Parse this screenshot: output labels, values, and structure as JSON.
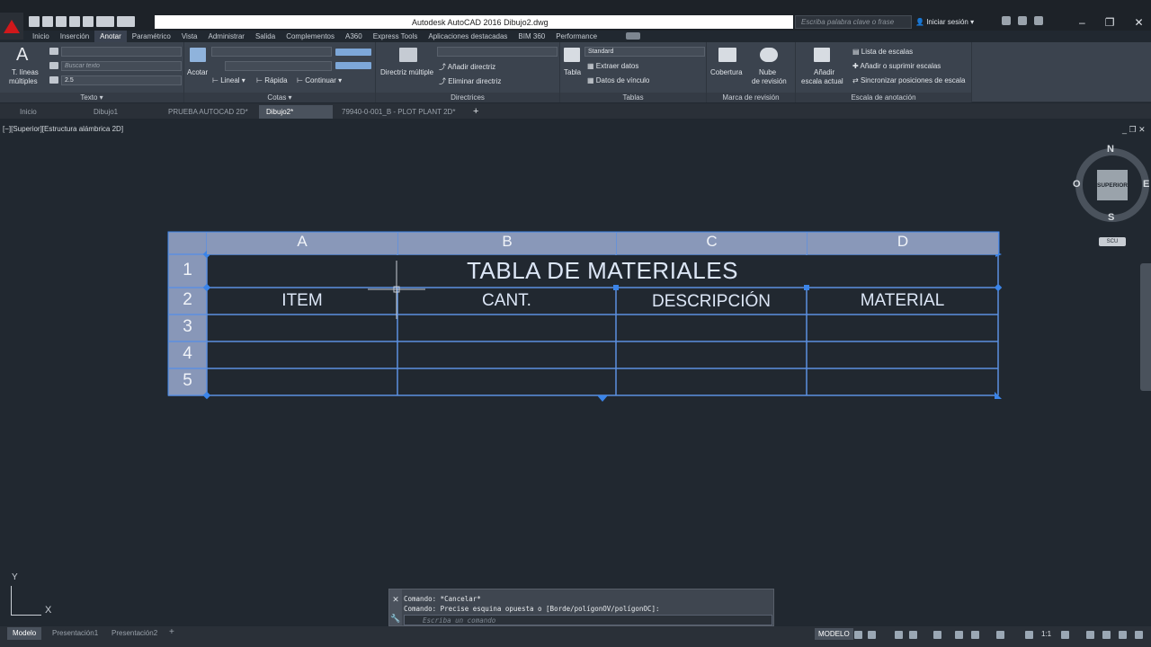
{
  "window": {
    "title": "Autodesk AutoCAD 2016   Dibujo2.dwg",
    "search_placeholder": "Escriba palabra clave o frase",
    "login": "Iniciar sesión"
  },
  "ribbon_tabs": [
    "Inicio",
    "Inserción",
    "Anotar",
    "Paramétrico",
    "Vista",
    "Administrar",
    "Salida",
    "Complementos",
    "A360",
    "Express Tools",
    "Aplicaciones destacadas",
    "BIM 360",
    "Performance"
  ],
  "ribbon": {
    "texto": {
      "multiline_label_1": "T. líneas",
      "multiline_label_2": "múltiples",
      "search_placeholder": "Buscar texto",
      "height_value": "2.5",
      "panel_title": "Texto"
    },
    "cotas": {
      "acotar": "Acotar",
      "lineal": "Lineal",
      "rapida": "Rápida",
      "continuar": "Continuar",
      "panel_title": "Cotas"
    },
    "directrices": {
      "multiple": "Directriz múltiple",
      "add": "Añadir directriz",
      "remove": "Eliminar directriz",
      "panel_title": "Directrices"
    },
    "tablas": {
      "tabla": "Tabla",
      "style": "Standard",
      "extract": "Extraer datos",
      "link": "Datos de vínculo",
      "panel_title": "Tablas"
    },
    "revision": {
      "cobertura": "Cobertura",
      "nube_1": "Nube",
      "nube_2": "de revisión",
      "panel_title": "Marca de revisión"
    },
    "escala": {
      "add_1": "Añadir",
      "add_2": "escala actual",
      "list": "Lista de escalas",
      "add_remove": "Añadir o suprimir escalas",
      "sync": "Sincronizar posiciones de escala",
      "panel_title": "Escala de anotación"
    }
  },
  "doc_tabs": [
    "Inicio",
    "Dibujo1",
    "PRUEBA AUTOCAD 2D*",
    "Dibujo2*",
    "79940-0-001_B - PLOT PLANT 2D*"
  ],
  "viewport_label": "[−][Superior][Estructura alámbrica 2D]",
  "viewport_controls": "_ ❐ ✕",
  "viewcube": {
    "face": "SUPERIOR",
    "n": "N",
    "s": "S",
    "e": "E",
    "w": "O",
    "ucs": "SCU"
  },
  "table": {
    "columns": [
      "A",
      "B",
      "C",
      "D"
    ],
    "rows": [
      "1",
      "2",
      "3",
      "4",
      "5"
    ],
    "title": "TABLA DE MATERIALES",
    "headers": [
      "ITEM",
      "CANT.",
      "DESCRIPCIÓN",
      "MATERIAL"
    ]
  },
  "ucs": {
    "x": "X",
    "y": "Y"
  },
  "command": {
    "line1": "Comando: *Cancelar*",
    "line2": "Comando: Precise esquina opuesta o [Borde/polígonOV/polígonOC]:",
    "placeholder": "Escriba un comando"
  },
  "status": {
    "tabs": [
      "Modelo",
      "Presentación1",
      "Presentación2"
    ],
    "model": "MODELO",
    "scale": "1:1"
  }
}
